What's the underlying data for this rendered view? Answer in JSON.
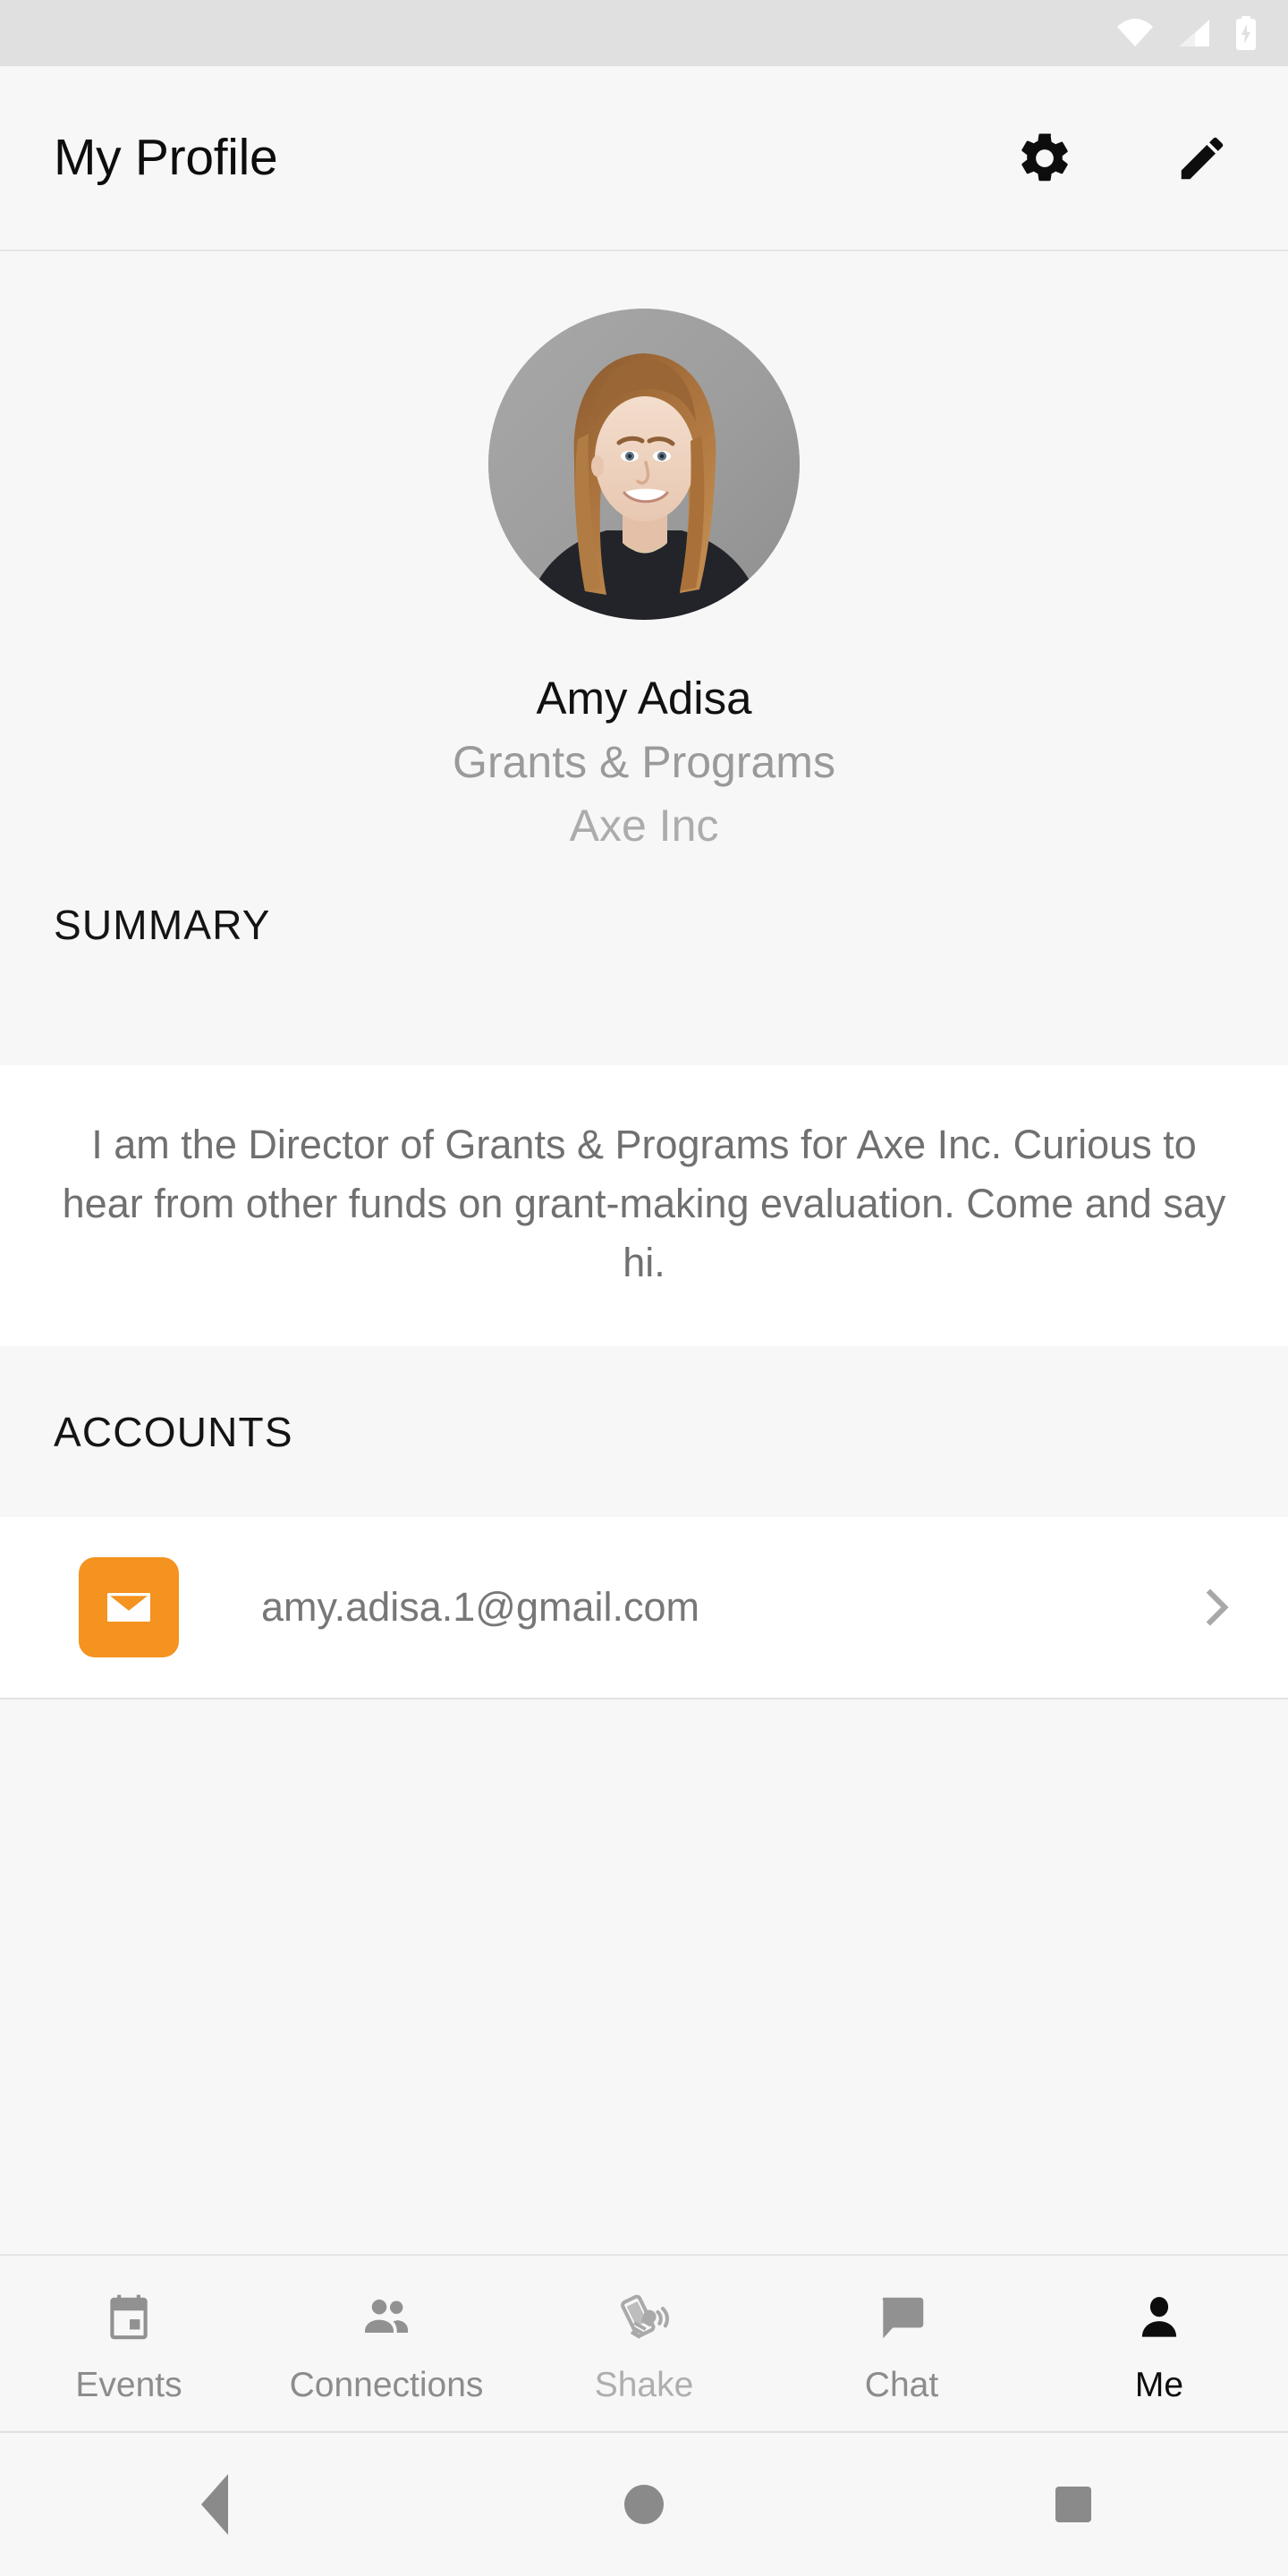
{
  "status_bar": {
    "icons": [
      "wifi-icon",
      "cellular-signal-icon",
      "battery-charging-icon"
    ]
  },
  "app_bar": {
    "title": "My Profile",
    "actions": [
      {
        "name": "settings-button",
        "icon": "gear-icon"
      },
      {
        "name": "edit-profile-button",
        "icon": "pencil-icon"
      }
    ]
  },
  "profile": {
    "avatar_alt": "profile-photo",
    "name": "Amy Adisa",
    "role": "Grants & Programs",
    "company": "Axe Inc"
  },
  "summary": {
    "header": "SUMMARY",
    "text": "I am the Director of Grants & Programs for Axe Inc. Curious to hear from other funds on grant-making evaluation. Come and say hi."
  },
  "accounts": {
    "header": "ACCOUNTS",
    "items": [
      {
        "icon": "email-icon",
        "label": "amy.adisa.1@gmail.com",
        "chevron": "chevron-right-icon"
      }
    ]
  },
  "tab_bar": {
    "tabs": [
      {
        "label": "Events",
        "icon": "calendar-icon",
        "active": false
      },
      {
        "label": "Connections",
        "icon": "people-icon",
        "active": false
      },
      {
        "label": "Shake",
        "icon": "shake-phone-icon",
        "active": false
      },
      {
        "label": "Chat",
        "icon": "speech-bubble-icon",
        "active": false
      },
      {
        "label": "Me",
        "icon": "person-icon",
        "active": true
      }
    ]
  },
  "nav_bar": {
    "buttons": [
      "back-button",
      "home-button",
      "recents-button"
    ]
  },
  "colors": {
    "accent_orange": "#f4931f",
    "page_background": "#f7f7f7",
    "card_background": "#ffffff",
    "status_bar_background": "#e0e0e0",
    "muted_text": "#9a9a9a",
    "active_tab_text": "#0d0d0d"
  }
}
